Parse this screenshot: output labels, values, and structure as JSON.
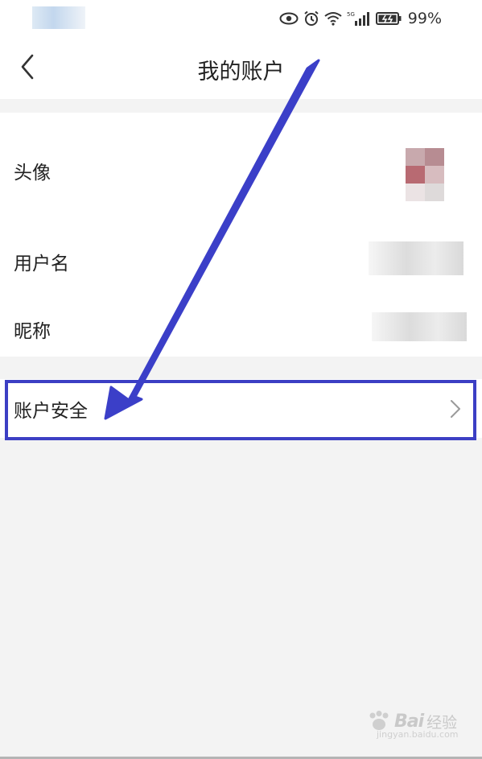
{
  "status_bar": {
    "battery_percent": "99%",
    "icons": [
      "eye-icon",
      "alarm-icon",
      "wifi-icon",
      "signal-5g-icon",
      "battery-charging-icon"
    ],
    "network_label": "5G"
  },
  "header": {
    "title": "我的账户",
    "back_icon": "chevron-left-icon"
  },
  "profile": {
    "avatar_label": "头像",
    "username_label": "用户名",
    "nickname_label": "昵称"
  },
  "security": {
    "label": "账户安全",
    "chevron_icon": "chevron-right-icon"
  },
  "annotation": {
    "arrow_color": "#3b3fc8",
    "box_color": "#3c3fc4"
  },
  "watermark": {
    "brand": "Bai",
    "brand_suffix": "经验",
    "url": "jingyan.baidu.com"
  }
}
